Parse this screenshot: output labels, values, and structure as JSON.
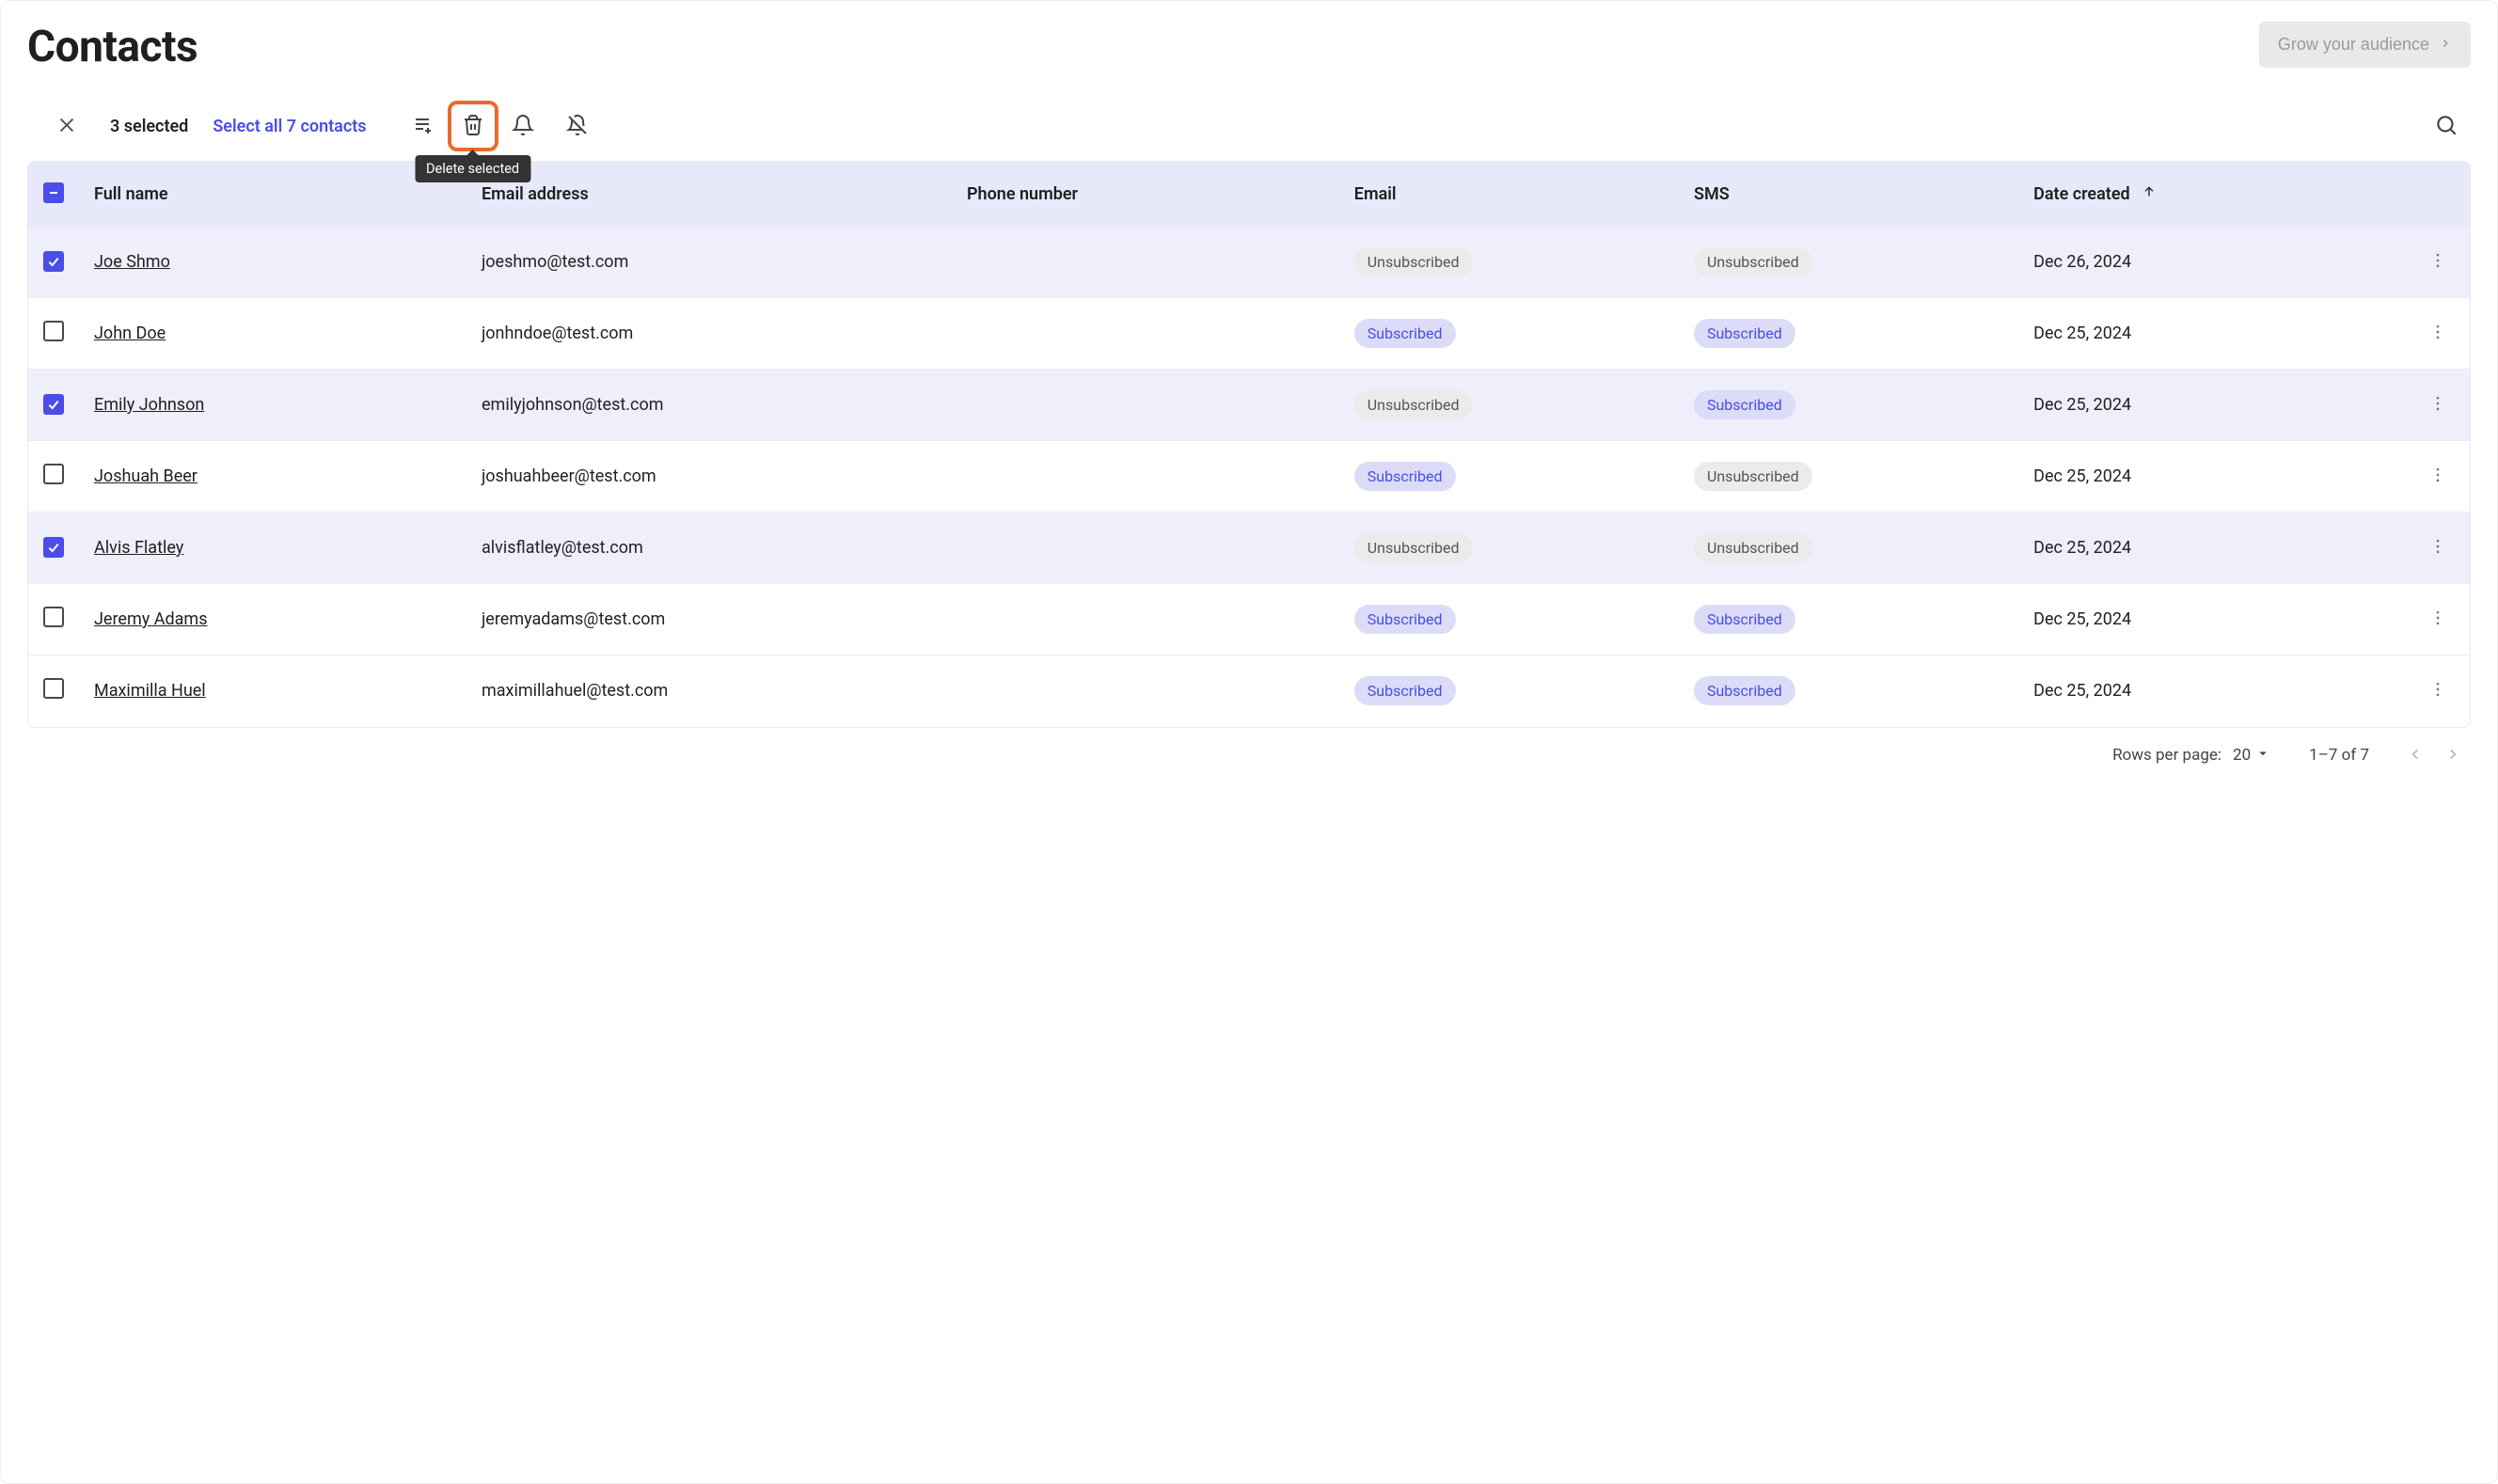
{
  "header": {
    "title": "Contacts",
    "grow_button": "Grow your audience"
  },
  "toolbar": {
    "selected_count": "3 selected",
    "select_all": "Select all 7 contacts",
    "delete_tooltip": "Delete selected"
  },
  "columns": {
    "full_name": "Full name",
    "email_address": "Email address",
    "phone_number": "Phone number",
    "email": "Email",
    "sms": "SMS",
    "date_created": "Date created"
  },
  "status_labels": {
    "subscribed": "Subscribed",
    "unsubscribed": "Unsubscribed"
  },
  "contacts": [
    {
      "selected": true,
      "name": "Joe Shmo",
      "email": "joeshmo@test.com",
      "phone": "",
      "email_status": "Unsubscribed",
      "sms_status": "Unsubscribed",
      "date": "Dec 26, 2024"
    },
    {
      "selected": false,
      "name": "John Doe",
      "email": "jonhndoe@test.com",
      "phone": "",
      "email_status": "Subscribed",
      "sms_status": "Subscribed",
      "date": "Dec 25, 2024"
    },
    {
      "selected": true,
      "name": "Emily Johnson",
      "email": "emilyjohnson@test.com",
      "phone": "",
      "email_status": "Unsubscribed",
      "sms_status": "Subscribed",
      "date": "Dec 25, 2024"
    },
    {
      "selected": false,
      "name": "Joshuah Beer",
      "email": "joshuahbeer@test.com",
      "phone": "",
      "email_status": "Subscribed",
      "sms_status": "Unsubscribed",
      "date": "Dec 25, 2024"
    },
    {
      "selected": true,
      "name": "Alvis Flatley",
      "email": "alvisflatley@test.com",
      "phone": "",
      "email_status": "Unsubscribed",
      "sms_status": "Unsubscribed",
      "date": "Dec 25, 2024"
    },
    {
      "selected": false,
      "name": "Jeremy Adams",
      "email": "jeremyadams@test.com",
      "phone": "",
      "email_status": "Subscribed",
      "sms_status": "Subscribed",
      "date": "Dec 25, 2024"
    },
    {
      "selected": false,
      "name": "Maximilla Huel",
      "email": "maximillahuel@test.com",
      "phone": "",
      "email_status": "Subscribed",
      "sms_status": "Subscribed",
      "date": "Dec 25, 2024"
    }
  ],
  "pagination": {
    "rows_per_page_label": "Rows per page:",
    "rows_per_page_value": "20",
    "range_text": "1–7 of 7"
  }
}
